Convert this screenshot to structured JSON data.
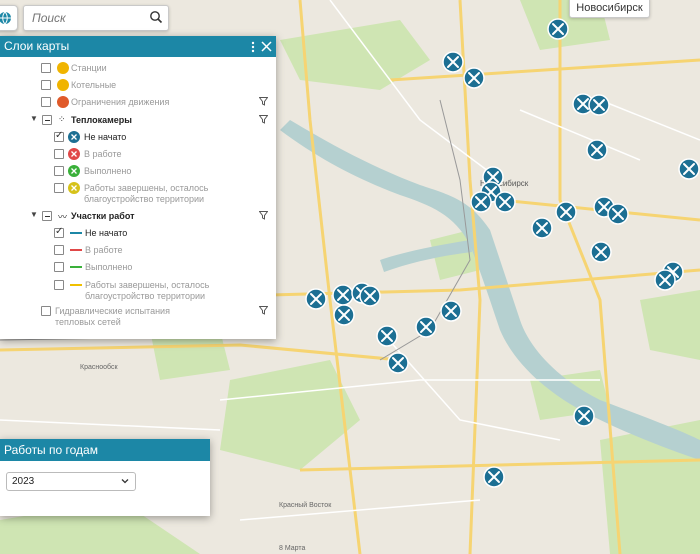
{
  "search": {
    "placeholder": "Поиск"
  },
  "map": {
    "city_label": "Новосибирск",
    "city_text": "Новосибирск",
    "places": [
      "Краснообск",
      "Красный Восток",
      "8 Марта"
    ],
    "colors": {
      "marker": "#1c6f93",
      "panel_header": "#1c87a6",
      "road": "#f6d472",
      "river": "#b5d0d0",
      "green": "#cfe5b3"
    }
  },
  "layers_panel": {
    "title": "Слои карты",
    "rows": [
      {
        "label": "Станции",
        "checked": false,
        "dim": true,
        "icon": "station-icon",
        "icon_color": "#f0b400"
      },
      {
        "label": "Котельные",
        "checked": false,
        "dim": true,
        "icon": "boiler-icon",
        "icon_color": "#f0b400"
      },
      {
        "label": "Ограничения движения",
        "checked": false,
        "dim": true,
        "icon": "restriction-icon",
        "icon_color": "#e05a2a",
        "filter": true
      },
      {
        "label": "Теплокамеры",
        "group": true,
        "bold": true,
        "icon": "dots-icon",
        "filter": true
      },
      {
        "label": "Не начато",
        "checked": true,
        "dim": false,
        "icon": "marker-icon",
        "icon_color": "#1c6f93"
      },
      {
        "label": "В работе",
        "checked": false,
        "dim": true,
        "icon": "marker-icon",
        "icon_color": "#e04848"
      },
      {
        "label": "Выполнено",
        "checked": false,
        "dim": true,
        "icon": "marker-icon",
        "icon_color": "#3ab03a"
      },
      {
        "label": "Работы завершены, осталось",
        "label2": "благоустройство территории",
        "checked": false,
        "dim": true,
        "icon": "marker-icon",
        "icon_color": "#d6c21a"
      },
      {
        "label": "Участки работ",
        "group": true,
        "bold": true,
        "icon": "zigzag-icon",
        "filter": true
      },
      {
        "label": "Не начато",
        "checked": true,
        "dim": false,
        "line_color": "#1c87a6"
      },
      {
        "label": "В работе",
        "checked": false,
        "dim": true,
        "line_color": "#e04848"
      },
      {
        "label": "Выполнено",
        "checked": false,
        "dim": true,
        "line_color": "#3ab03a"
      },
      {
        "label": "Работы завершены, осталось",
        "label2": "благоустройство территории",
        "checked": false,
        "dim": true,
        "line_color": "#f0c000"
      },
      {
        "label": "Гидравлические испытания",
        "label2": "тепловых сетей",
        "checked": false,
        "dim": true,
        "filter": true
      }
    ]
  },
  "years_panel": {
    "title": "Работы по годам",
    "selected": "2023"
  }
}
